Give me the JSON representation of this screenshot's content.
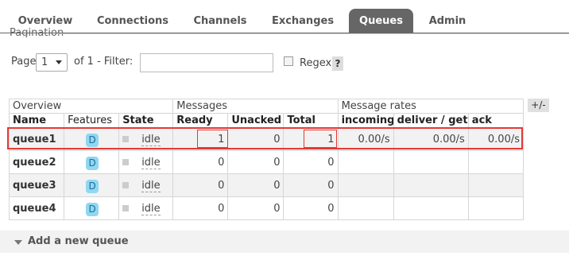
{
  "tabs": [
    "Overview",
    "Connections",
    "Channels",
    "Exchanges",
    "Queues",
    "Admin"
  ],
  "pagination": {
    "title": "Pagination",
    "page_label": "Page",
    "page_value": "1",
    "of_label": "of 1  - Filter:",
    "filter_value": "",
    "regex_label": "Regex",
    "help_label": "?"
  },
  "table": {
    "group_headers": [
      "Overview",
      "Messages",
      "Message rates"
    ],
    "columns": [
      "Name",
      "Features",
      "State",
      "Ready",
      "Unacked",
      "Total",
      "incoming",
      "deliver / get",
      "ack"
    ],
    "toggle_label": "+/-",
    "rows": [
      {
        "name": "queue1",
        "feature": "D",
        "state": "idle",
        "ready": "1",
        "unacked": "0",
        "total": "1",
        "incoming": "0.00/s",
        "deliver": "0.00/s",
        "ack": "0.00/s"
      },
      {
        "name": "queue2",
        "feature": "D",
        "state": "idle",
        "ready": "0",
        "unacked": "0",
        "total": "0",
        "incoming": "",
        "deliver": "",
        "ack": ""
      },
      {
        "name": "queue3",
        "feature": "D",
        "state": "idle",
        "ready": "0",
        "unacked": "0",
        "total": "0",
        "incoming": "",
        "deliver": "",
        "ack": ""
      },
      {
        "name": "queue4",
        "feature": "D",
        "state": "idle",
        "ready": "0",
        "unacked": "0",
        "total": "0",
        "incoming": "",
        "deliver": "",
        "ack": ""
      }
    ]
  },
  "add_queue": {
    "label": "Add a new queue"
  },
  "colors": {
    "active_tab": "#666666",
    "feature_badge": "#8fd7f2",
    "highlight": "#e53935"
  }
}
